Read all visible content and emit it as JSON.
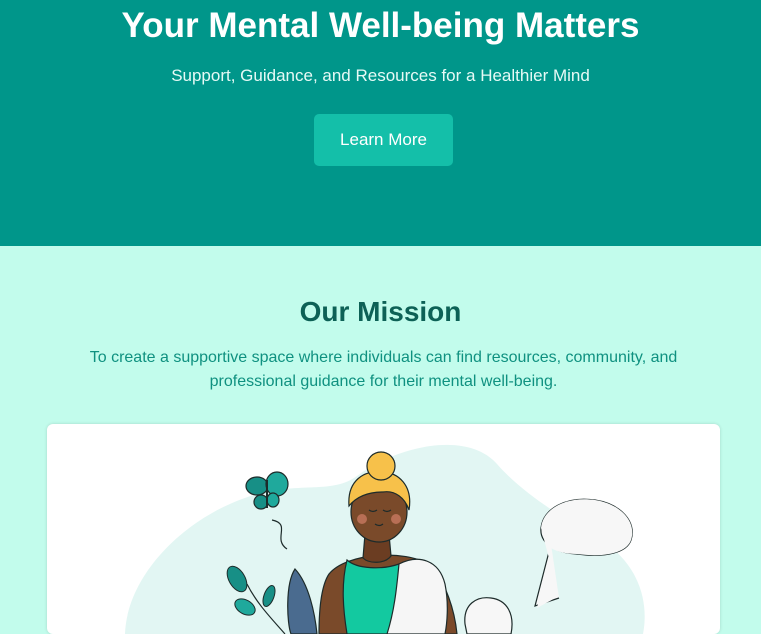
{
  "hero": {
    "title": "Your Mental Well-being Matters",
    "subtitle": "Support, Guidance, and Resources for a Healthier Mind",
    "cta_label": "Learn More"
  },
  "mission": {
    "title": "Our Mission",
    "text": "To create a supportive space where individuals can find resources, community, and professional guidance for their mental well-being."
  },
  "illustration": {
    "subject": "person-with-butterfly-plant-and-speech-bubbles"
  },
  "colors": {
    "hero_bg": "#00968a",
    "cta_bg": "#14bfa9",
    "page_bg": "#c2fcec",
    "heading": "#0d6156",
    "body_text": "#0f9180"
  }
}
